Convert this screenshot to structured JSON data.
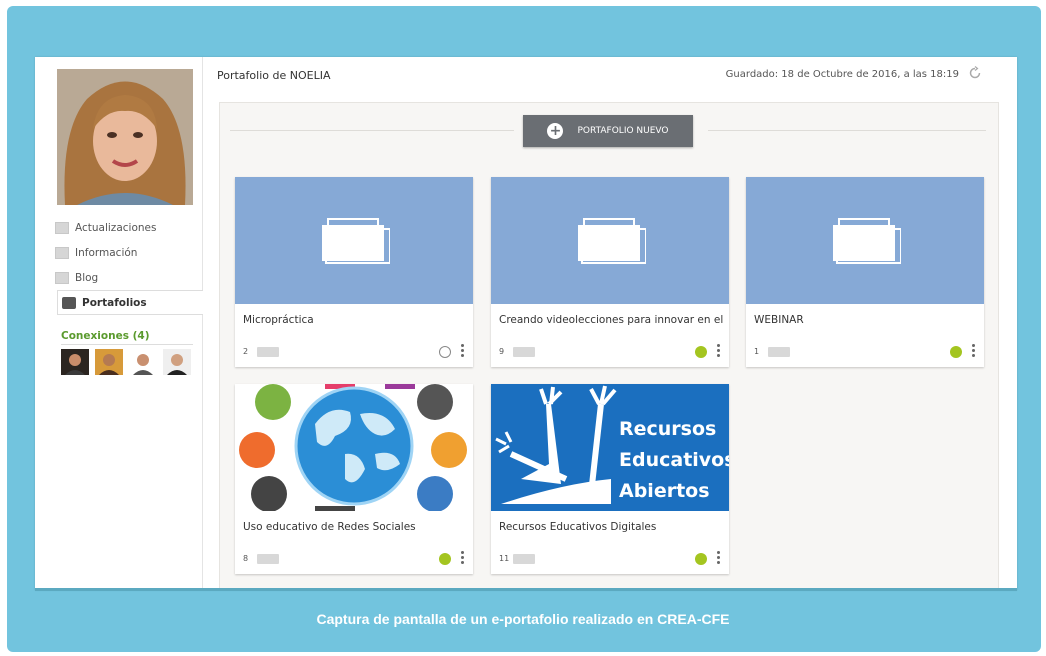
{
  "colors": {
    "frame": "#72c4de",
    "tile": "#86a9d6",
    "status_green": "#a4c520",
    "button": "#6a6e73",
    "connections": "#5a9a2d"
  },
  "header": {
    "title": "Portafolio de NOELIA",
    "saved": "Guardado: 18 de Octubre de 2016, a las 18:19"
  },
  "sidebar": {
    "items": [
      {
        "label": "Actualizaciones",
        "icon": "updates-icon"
      },
      {
        "label": "Información",
        "icon": "info-icon"
      },
      {
        "label": "Blog",
        "icon": "blog-icon"
      },
      {
        "label": "Portafolios",
        "icon": "portfolio-icon",
        "active": true
      }
    ],
    "connections_title": "Conexiones (4)"
  },
  "new_portfolio_label": "PORTAFOLIO NUEVO",
  "cards": [
    {
      "name": "Micropráctica",
      "count": "2",
      "status": "empty"
    },
    {
      "name": "Creando videolecciones para innovar en el ...",
      "count": "9",
      "status": "green"
    },
    {
      "name": "WEBINAR",
      "count": "1",
      "status": "green"
    },
    {
      "name": "Uso educativo de Redes Sociales",
      "count": "8",
      "status": "green"
    },
    {
      "name": "Recursos Educativos Digitales",
      "count": "11",
      "status": "green"
    }
  ],
  "oer_image_text": [
    "Recursos",
    "Educativos",
    "Abiertos"
  ],
  "caption": "Captura de pantalla de un e-portafolio realizado en CREA-CFE"
}
